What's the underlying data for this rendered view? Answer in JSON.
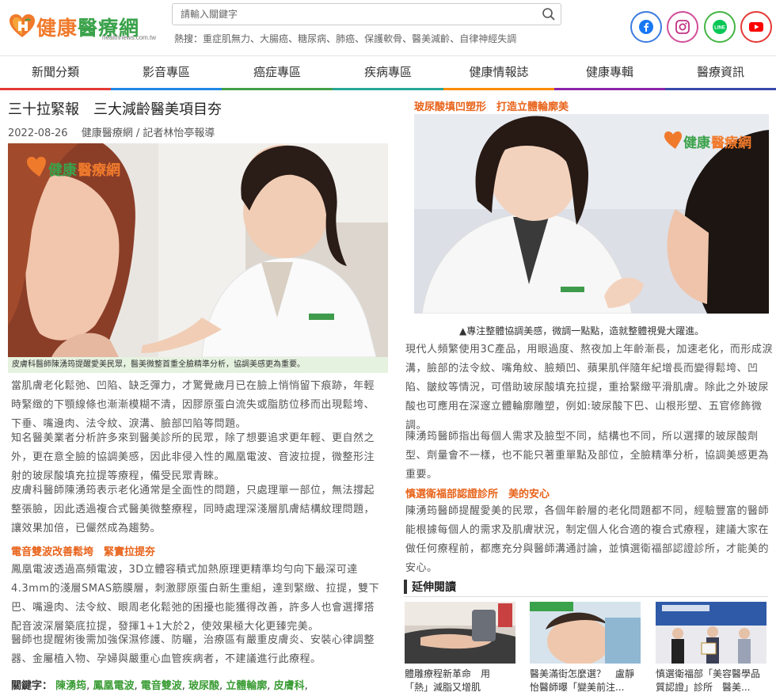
{
  "header": {
    "logo_main": "健康",
    "logo_accent": "醫療網",
    "logo_url": "healthnews.com.tw",
    "search_placeholder": "請輸入關鍵字",
    "hot_label": "熱搜：",
    "hot_tags": [
      "重症肌無力",
      "大腸癌",
      "糖尿病",
      "肺癌",
      "保護軟骨",
      "醫美減齡",
      "自律神經失調"
    ],
    "social": [
      "facebook-icon",
      "instagram-icon",
      "line-icon",
      "youtube-icon"
    ]
  },
  "nav": {
    "items": [
      "新聞分類",
      "影音專區",
      "癌症專區",
      "疾病專區",
      "健康情報誌",
      "健康專輯",
      "醫療資訊"
    ],
    "colors": [
      "#e53935",
      "#1e88e5",
      "#43a047",
      "#26a69a",
      "#fb8c00",
      "#8e24aa",
      "#3949ab"
    ]
  },
  "article": {
    "title": "三十拉緊報　三大減齡醫美項目夯",
    "date": "2022-08-26",
    "byline": "健康醫療網 / 記者林怡亭報導",
    "photo_watermark_main": "健康",
    "photo_watermark_accent": "醫療網",
    "caption_left": "皮膚科醫師陳湧筠提醒愛美民眾，醫美微整首重全臉精準分析，協調美感更為重要。",
    "left_paragraphs": [
      [
        "當肌膚老化鬆弛、凹陷、缺乏彈力，才驚覺歲月已在臉上悄悄留下痕跡，年輕",
        "時緊緻的下顎線條也漸漸模糊不清，因膠原蛋白流失或脂肪位移而出現鬆垮、",
        "下垂、嘴邊肉、法令紋、淚溝、臉部凹陷等問題。"
      ],
      [
        "知名醫美業者分析許多來到醫美診所的民眾，除了想要追求更年輕、更自然之",
        "外，更在意全臉的協調美感，因此非侵入性的鳳凰電波、音波拉提，微整形注",
        "射的玻尿酸填充拉提等療程，備受民眾青睞。"
      ],
      [
        "皮膚科醫師陳湧筠表示老化通常是全面性的問題，只處理單一部位，無法撐起",
        "整張臉，因此透過複合式醫美微整療程，同時處理深淺層肌膚結構紋理問題，",
        "讓效果加倍，已儼然成為趨勢。"
      ]
    ],
    "subhead_1": "電音雙波改善鬆垮　緊實拉提夯",
    "left_paragraphs_2": [
      [
        "鳳凰電波透過高頻電波，3D立體容積式加熱原理更精準均勻向下最深可達",
        "4.3mm的淺層SMAS筋膜層，刺激膠原蛋白新生重組，達到緊緻、拉提，雙下",
        "巴、嘴邊肉、法令紋、眼周老化鬆弛的困擾也能獲得改善，許多人也會選擇搭",
        "配音波深層築底拉提，發揮1+1大於2，使效果極大化更臻完美。"
      ],
      [
        "醫師也提醒術後需加強保濕修護、防曬，治療區有嚴重皮膚炎、安裝心律調整",
        "器、金屬植入物、孕婦與嚴重心血管疾病者，不建議進行此療程。"
      ]
    ],
    "keywords_label": "關鍵字：",
    "keywords": [
      "陳湧筠",
      "鳳凰電波",
      "電音雙波",
      "玻尿酸",
      "立體輪廓",
      "皮膚科"
    ],
    "subhead_right_1": "玻尿酸填凹塑形　打造立體輪廓美",
    "caption_right": "▲專注整體協調美感，微調一點點，造就整體視覺大躍進。",
    "right_paragraphs": [
      [
        "現代人頻繁使用3C產品，用眼過度、熬夜加上年齡漸長，加速老化，而形成淚",
        "溝，臉部的法令紋、嘴角紋、臉頰凹、蘋果肌伴隨年紀增長而變得鬆垮、凹",
        "陷、皺紋等情況，可借助玻尿酸填充拉提，重拾緊緻平滑肌膚。除此之外玻尿",
        "酸也可應用在深邃立體輪廓雕塑，例如:玻尿酸下巴、山根形塑、五官修飾微",
        "調。"
      ],
      [
        "陳湧筠醫師指出每個人需求及臉型不同，結構也不同，所以選擇的玻尿酸劑",
        "型、劑量會不一樣，也不能只著重單點及部位，全臉精準分析，協調美感更為",
        "重要。"
      ]
    ],
    "subhead_right_2": "慎選衛福部認證診所　美的安心",
    "right_paragraphs_2": [
      [
        "陳湧筠醫師提醒愛美的民眾，各個年齡層的老化問題都不同，經驗豐富的醫師",
        "能根據每個人的需求及肌膚狀況，制定個人化合適的複合式療程，建議大家在",
        "做任何療程前，都應充分與醫師溝通討論，並慎選衛福部認證診所，才能美的",
        "安心。"
      ]
    ]
  },
  "extended": {
    "heading": "延伸閱讀",
    "items": [
      {
        "title_1": "體雕療程新革命　用",
        "title_2": "「熱」減脂又增肌"
      },
      {
        "title_1": "醫美滿街怎麼選？　盧靜",
        "title_2": "怡醫師曝「變美前注..."
      },
      {
        "title_1": "慎選衛福部「美容醫學品",
        "title_2": "質認證」診所　醫美..."
      }
    ]
  }
}
